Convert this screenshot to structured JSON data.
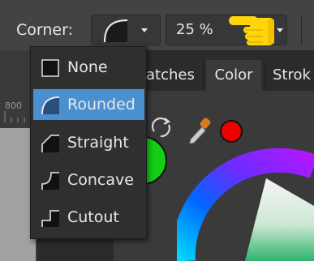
{
  "toolbar": {
    "corner_label": "Corner:",
    "selected_corner_icon": "rounded-corner-icon",
    "zoom_value": "25 %",
    "hand_icon": "pointing-hand-icon"
  },
  "ruler": {
    "tick_label": "800"
  },
  "panel": {
    "tabs": [
      {
        "label": "atches",
        "active": false
      },
      {
        "label": "Color",
        "active": true
      },
      {
        "label": "Strok",
        "active": false
      }
    ],
    "fill_color": "#14cf14",
    "swatch_color": "#ee0000"
  },
  "corner_menu": {
    "items": [
      {
        "label": "None",
        "icon": "none-corner-icon",
        "selected": false
      },
      {
        "label": "Rounded",
        "icon": "rounded-corner-icon",
        "selected": true
      },
      {
        "label": "Straight",
        "icon": "straight-corner-icon",
        "selected": false
      },
      {
        "label": "Concave",
        "icon": "concave-corner-icon",
        "selected": false
      },
      {
        "label": "Cutout",
        "icon": "cutout-corner-icon",
        "selected": false
      }
    ]
  },
  "colors": {
    "toolbar_bg": "#434343",
    "panel_bg": "#3a3a3a",
    "menu_bg": "#2f2f2f",
    "selection": "#4a8fd0",
    "hand": "#ffd60a"
  }
}
